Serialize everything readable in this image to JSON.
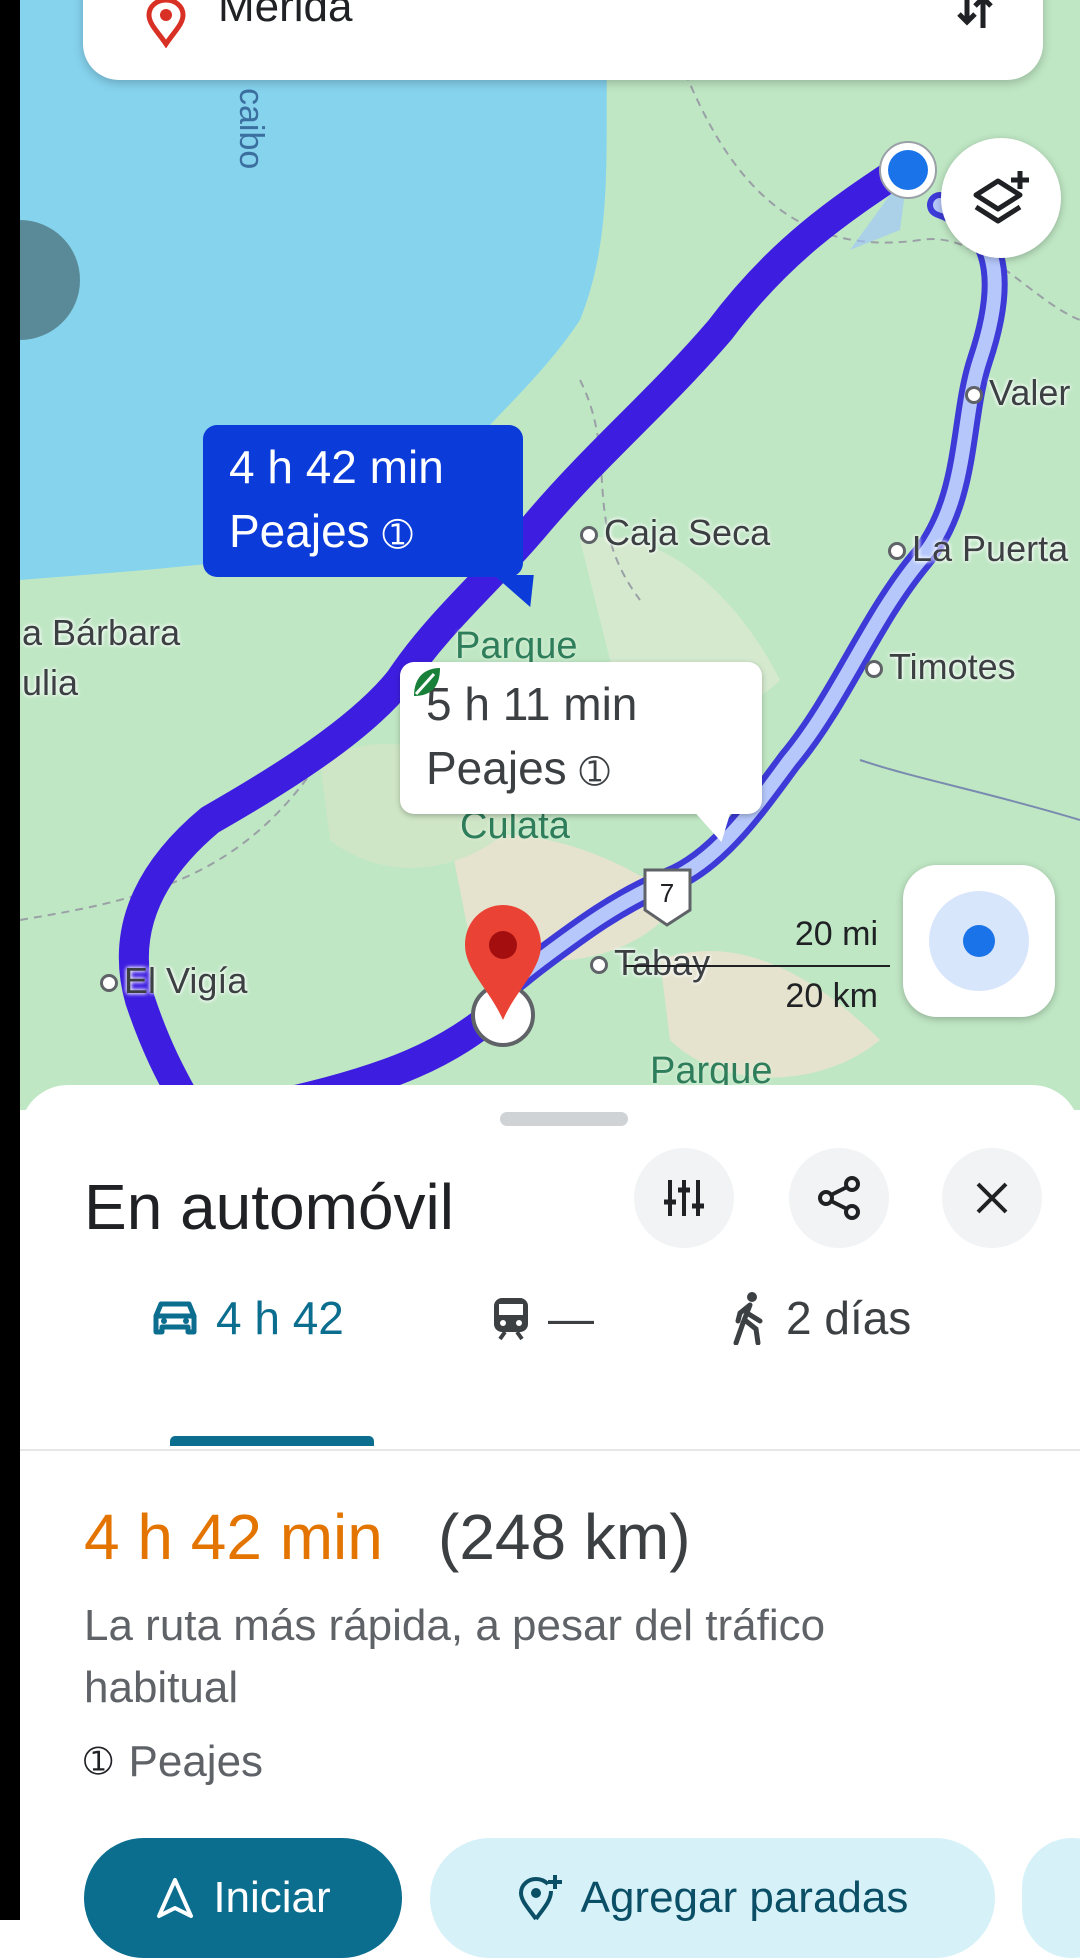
{
  "search": {
    "destination": "Mérida"
  },
  "map": {
    "water_label": "caibo",
    "places": [
      {
        "name": "Caja Seca"
      },
      {
        "name": "La Puerta"
      },
      {
        "name": "Timotes"
      },
      {
        "name": "Valer"
      },
      {
        "name": "El Vigía"
      },
      {
        "name": "Tabay"
      },
      {
        "name": "a Bárbara"
      },
      {
        "name": "ulia"
      }
    ],
    "park_labels": [
      "Parque",
      "Culata",
      "Parque"
    ],
    "road_shield": "7",
    "scale": {
      "miles": "20 mi",
      "km": "20 km"
    }
  },
  "routes": {
    "primary": {
      "time": "4 h 42 min",
      "tolls": "Peajes"
    },
    "alternative": {
      "time": "5 h 11 min",
      "tolls": "Peajes"
    }
  },
  "sheet": {
    "title": "En automóvil",
    "tabs": [
      {
        "label": "4 h 42",
        "icon": "car-icon"
      },
      {
        "label": "—",
        "icon": "train-icon"
      },
      {
        "label": "2 días",
        "icon": "walk-icon"
      }
    ],
    "duration": "4 h 42 min",
    "distance": "(248 km)",
    "description": "La ruta más rápida, a pesar del tráfico habitual",
    "tolls": "Peajes",
    "start_label": "Iniciar",
    "add_stops_label": "Agregar paradas"
  },
  "colors": {
    "primary_route": "#3d1ee0",
    "alt_route": "#8ea8f5",
    "accent_teal": "#0b6e8f",
    "duration_orange": "#e37400",
    "water": "#86d3ee",
    "land": "#bfe7c4"
  }
}
